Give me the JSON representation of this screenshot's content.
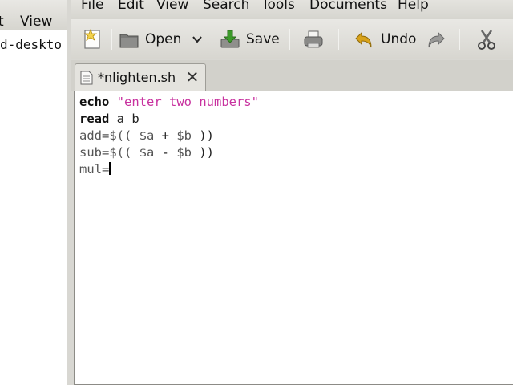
{
  "background_window": {
    "menus": [
      "t",
      "View"
    ],
    "path_text": "d-deskto"
  },
  "menubar": {
    "items": [
      "File",
      "Edit",
      "View",
      "Search",
      "Tools",
      "Documents",
      "Help"
    ]
  },
  "toolbar": {
    "open_label": "Open",
    "save_label": "Save",
    "undo_label": "Undo"
  },
  "tab": {
    "label": "*nlighten.sh"
  },
  "editor": {
    "lines": [
      {
        "kw": "echo",
        "rest": " ",
        "str": "\"enter two numbers\""
      },
      {
        "kw": "read",
        "rest": " a b"
      },
      {
        "plain": "add=$(( ",
        "var1": "$a",
        "op": " + ",
        "var2": "$b",
        "end": " ))"
      },
      {
        "plain": "sub=$(( ",
        "var1": "$a",
        "op": " - ",
        "var2": "$b",
        "end": " ))"
      },
      {
        "plain": "mul="
      }
    ]
  },
  "colors": {
    "string": "#c8329f",
    "undo_arrow": "#d8a21a",
    "save_arrow": "#3c9a2a"
  }
}
